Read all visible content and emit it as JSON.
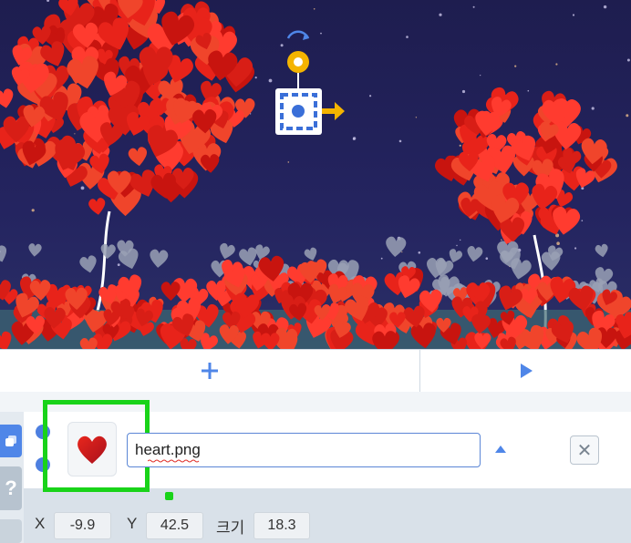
{
  "stage": {
    "background": "#1e1d4f",
    "heart_color": "#e8231a",
    "gray_heart_color": "#9aa1b5"
  },
  "controls": {
    "add_icon": "plus-icon",
    "play_icon": "play-icon",
    "accent": "#4f86e8"
  },
  "sprite": {
    "name": "heart.png",
    "thumbnail_icon": "heart-icon",
    "x_label": "X",
    "x_value": "-9.9",
    "y_label": "Y",
    "y_value": "42.5",
    "size_label": "크기",
    "size_value": "18.3"
  },
  "sidebar": {
    "help_label": "?"
  },
  "close_label": "✕",
  "highlight_color": "#19d319"
}
